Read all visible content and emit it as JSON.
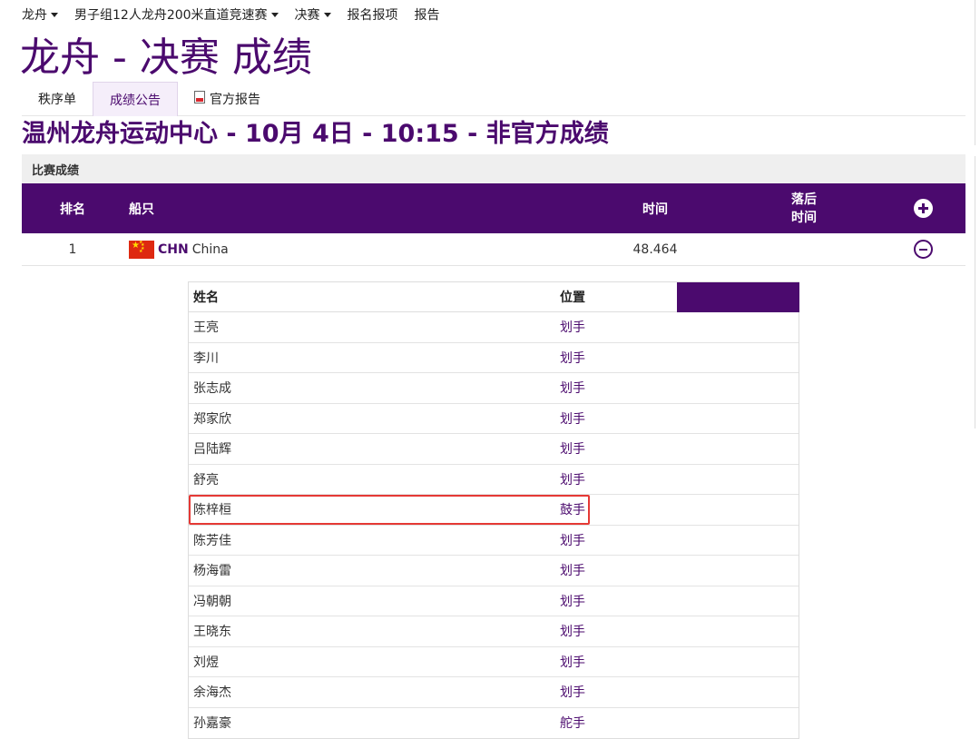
{
  "nav": {
    "items": [
      {
        "label": "龙舟",
        "dropdown": true
      },
      {
        "label": "男子组12人龙舟200米直道竞速赛",
        "dropdown": true
      },
      {
        "label": "决赛",
        "dropdown": true
      },
      {
        "label": "报名报项",
        "dropdown": false
      },
      {
        "label": "报告",
        "dropdown": false
      }
    ]
  },
  "page_title": "龙舟 - 决赛 成绩",
  "tabs": {
    "start_list": "秩序单",
    "results": "成绩公告",
    "official_report": "官方报告"
  },
  "subtitle": "温州龙舟运动中心 - 10月 4日 - 10:15 - 非官方成绩",
  "section_title": "比赛成绩",
  "results_table": {
    "headers": {
      "rank": "排名",
      "boat": "船只",
      "time": "时间",
      "behind_line1": "落后",
      "behind_line2": "时间"
    },
    "rows": [
      {
        "rank": "1",
        "noc": "CHN",
        "country": "China",
        "time": "48.464",
        "behind": ""
      }
    ]
  },
  "crew": {
    "headers": {
      "name": "姓名",
      "position": "位置"
    },
    "members": [
      {
        "name": "王亮",
        "position": "划手"
      },
      {
        "name": "李川",
        "position": "划手"
      },
      {
        "name": "张志成",
        "position": "划手"
      },
      {
        "name": "郑家欣",
        "position": "划手"
      },
      {
        "name": "吕陆辉",
        "position": "划手"
      },
      {
        "name": "舒亮",
        "position": "划手"
      },
      {
        "name": "陈梓桓",
        "position": "鼓手"
      },
      {
        "name": "陈芳佳",
        "position": "划手"
      },
      {
        "name": "杨海雷",
        "position": "划手"
      },
      {
        "name": "冯朝朝",
        "position": "划手"
      },
      {
        "name": "王晓东",
        "position": "划手"
      },
      {
        "name": "刘煜",
        "position": "划手"
      },
      {
        "name": "余海杰",
        "position": "划手"
      },
      {
        "name": "孙嘉豪",
        "position": "舵手"
      }
    ]
  },
  "colors": {
    "brand_purple": "#4b0a6e",
    "highlight_red": "#e53935",
    "flag_red": "#de2910"
  },
  "icons": {
    "expand": "plus-circle-icon",
    "collapse": "minus-circle-icon",
    "report": "pdf-document-icon",
    "flag": "china-flag-icon"
  }
}
